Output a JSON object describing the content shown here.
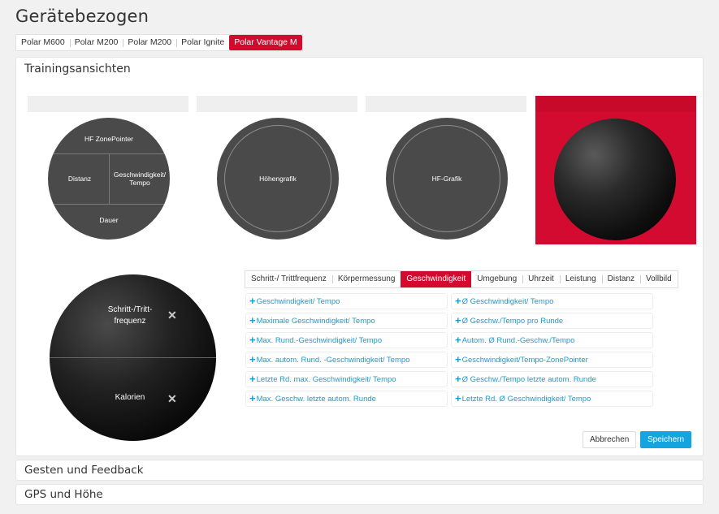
{
  "page_title": "Gerätebezogen",
  "device_tabs": [
    "Polar M600",
    "Polar M200",
    "Polar M200",
    "Polar Ignite",
    "Polar Vantage M"
  ],
  "active_device_tab": 4,
  "section": {
    "title": "Trainingsansichten",
    "views": [
      {
        "name": "view-1",
        "labels": {
          "top": "HF ZonePointer",
          "left": "Distanz",
          "right": "Geschwindigkeit/ Tempo",
          "bottom": "Dauer"
        }
      },
      {
        "name": "view-2",
        "label": "Höhengrafik"
      },
      {
        "name": "view-3",
        "label": "HF-Grafik"
      },
      {
        "name": "view-4",
        "label": ""
      }
    ],
    "editor": {
      "top_label": "Schritt-/Tritt-\nfrequenz",
      "bottom_label": "Kalorien",
      "remove_glyph": "✕"
    },
    "category_tabs": [
      "Schritt-/ Trittfrequenz",
      "Körpermessung",
      "Geschwindigkeit",
      "Umgebung",
      "Uhrzeit",
      "Leistung",
      "Distanz",
      "Vollbild"
    ],
    "active_category": 2,
    "options_left": [
      "Geschwindigkeit/ Tempo",
      "Maximale Geschwindigkeit/ Tempo",
      "Max. Rund.-Geschwindigkeit/ Tempo",
      "Max. autom. Rund. -Geschwindigkeit/ Tempo",
      "Letzte Rd. max. Geschwindigkeit/ Tempo",
      "Max. Geschw. letzte autom. Runde"
    ],
    "options_right": [
      "Ø Geschwindigkeit/ Tempo",
      "Ø Geschw./Tempo pro Runde",
      "Autom. Ø Rund.-Geschw./Tempo",
      "Geschwindigkeit/Tempo-ZonePointer",
      "Ø Geschw./Tempo letzte autom. Runde",
      "Letzte Rd. Ø Geschwindigkeit/ Tempo"
    ],
    "cancel_label": "Abbrechen",
    "save_label": "Speichern"
  },
  "collapsed_sections": [
    "Gesten und Feedback",
    "GPS und Höhe"
  ],
  "colors": {
    "accent_red": "#d20a2e",
    "link_blue": "#1a9ad6",
    "save_blue": "#14a5e0"
  },
  "icons": {
    "add": "plus-icon",
    "remove": "close-icon"
  }
}
